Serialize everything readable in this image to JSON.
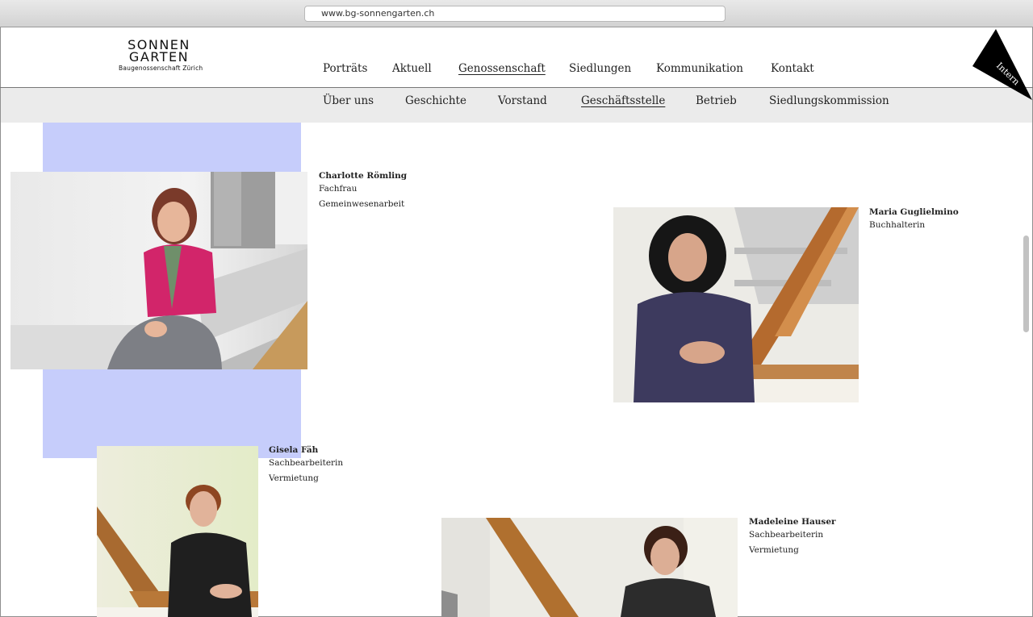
{
  "browser": {
    "url": "www.bg-sonnengarten.ch"
  },
  "logo": {
    "line1": "SONNEN",
    "line2": "GARTEN",
    "line3": "Baugenossenschaft Zürich"
  },
  "main_nav": {
    "items": [
      {
        "label": "Porträts"
      },
      {
        "label": "Aktuell"
      },
      {
        "label": "Genossenschaft",
        "active": true
      },
      {
        "label": "Siedlungen"
      },
      {
        "label": "Kommunikation"
      },
      {
        "label": "Kontakt"
      }
    ]
  },
  "sub_nav": {
    "items": [
      {
        "label": "Über uns"
      },
      {
        "label": "Geschichte"
      },
      {
        "label": "Vorstand"
      },
      {
        "label": "Geschäftsstelle",
        "active": true
      },
      {
        "label": "Betrieb"
      },
      {
        "label": "Siedlungskommission"
      }
    ]
  },
  "intern_label": "Intern",
  "colors": {
    "accent_block": "#c6cdfb",
    "subnav_bg": "#ebebeb"
  },
  "staff": [
    {
      "name": "Charlotte Römling",
      "role": "Fachfrau",
      "department": "Gemeinwesenarbeit"
    },
    {
      "name": "Maria Guglielmino",
      "role": "Buchhalterin"
    },
    {
      "name": "Gisela Fäh",
      "role": "Sachbearbeiterin",
      "department": "Vermietung"
    },
    {
      "name": "Madeleine Hauser",
      "role": "Sachbearbeiterin",
      "department": "Vermietung"
    }
  ]
}
